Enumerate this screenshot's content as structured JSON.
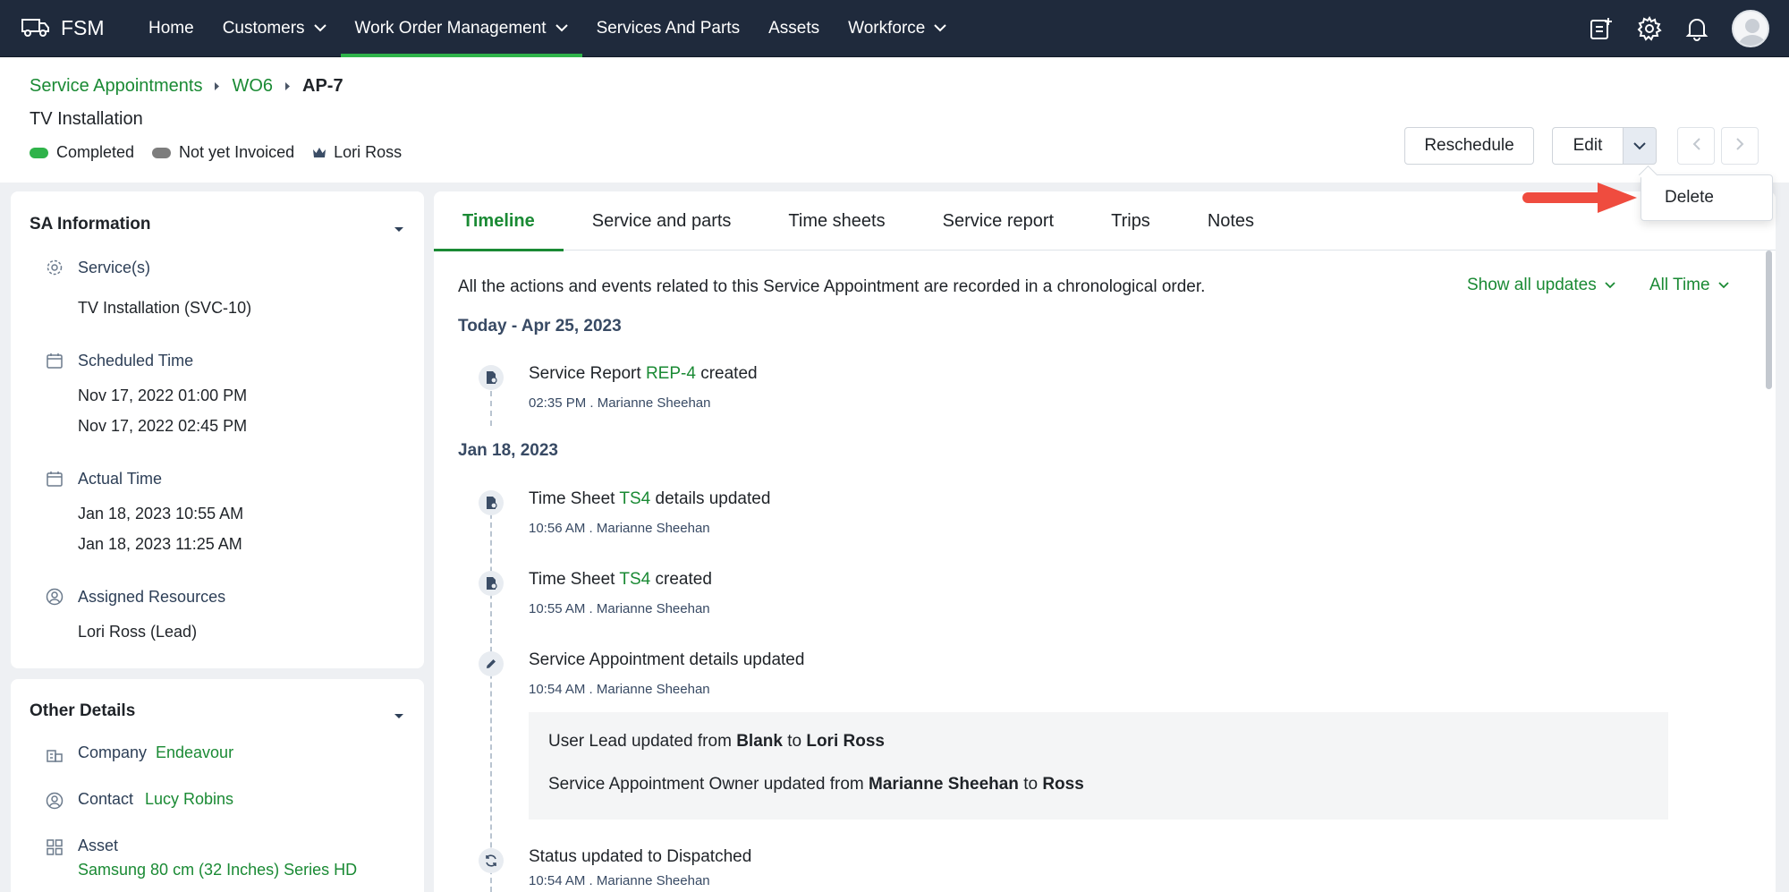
{
  "app": {
    "name": "FSM"
  },
  "nav": {
    "items": [
      {
        "label": "Home"
      },
      {
        "label": "Customers"
      },
      {
        "label": "Work Order Management"
      },
      {
        "label": "Services And Parts"
      },
      {
        "label": "Assets"
      },
      {
        "label": "Workforce"
      }
    ]
  },
  "breadcrumb": {
    "level1": "Service Appointments",
    "level2": "WO6",
    "current": "AP-7"
  },
  "header": {
    "title": "TV Installation",
    "status": "Completed",
    "invoice_status": "Not yet Invoiced",
    "owner": "Lori Ross",
    "reschedule_label": "Reschedule",
    "edit_label": "Edit"
  },
  "dropdown": {
    "delete_label": "Delete"
  },
  "colors": {
    "accent": "#1a8a34",
    "nav_bg": "#1f2a3c",
    "completed": "#2fb34a",
    "not_invoiced": "#7d7d7d",
    "annotation": "#ef4c3f"
  },
  "sa_info": {
    "title": "SA Information",
    "services_label": "Service(s)",
    "services_value": "TV Installation (SVC-10)",
    "scheduled_label": "Scheduled Time",
    "scheduled_start": "Nov 17, 2022 01:00 PM",
    "scheduled_end": "Nov 17, 2022 02:45 PM",
    "actual_label": "Actual Time",
    "actual_start": "Jan 18, 2023 10:55 AM",
    "actual_end": "Jan 18, 2023 11:25 AM",
    "resources_label": "Assigned Resources",
    "resources_value": "Lori Ross (Lead)"
  },
  "other_details": {
    "title": "Other Details",
    "company_label": "Company",
    "company_value": "Endeavour",
    "contact_label": "Contact",
    "contact_value": "Lucy Robins",
    "asset_label": "Asset",
    "asset_value": "Samsung 80 cm (32 Inches) Series HD"
  },
  "tabs": [
    {
      "label": "Timeline"
    },
    {
      "label": "Service and parts"
    },
    {
      "label": "Time sheets"
    },
    {
      "label": "Service report"
    },
    {
      "label": "Trips"
    },
    {
      "label": "Notes"
    }
  ],
  "timeline": {
    "intro": "All the actions and events related to this Service Appointment are recorded in a chronological order.",
    "filter_updates": "Show all updates",
    "filter_time": "All Time",
    "groups": [
      {
        "date": "Today - Apr 25, 2023"
      },
      {
        "date": "Jan 18, 2023"
      }
    ],
    "events": [
      {
        "prefix": "Service Report ",
        "link": "REP-4",
        "suffix": " created",
        "meta": "02:35 PM . Marianne Sheehan"
      },
      {
        "prefix": "Time Sheet ",
        "link": "TS4",
        "suffix": " details updated",
        "meta": "10:56 AM . Marianne Sheehan"
      },
      {
        "prefix": "Time Sheet ",
        "link": "TS4",
        "suffix": " created",
        "meta": "10:55 AM . Marianne Sheehan"
      },
      {
        "text": "Service Appointment details updated",
        "meta": "10:54 AM . Marianne Sheehan"
      },
      {
        "text": "Status updated to Dispatched",
        "meta": "10:54 AM . Marianne Sheehan"
      }
    ],
    "details": {
      "line1_prefix": "User Lead updated from ",
      "line1_from": "Blank",
      "line1_mid": " to ",
      "line1_to": "Lori Ross",
      "line2_prefix": "Service Appointment Owner updated from ",
      "line2_from": "Marianne Sheehan",
      "line2_mid": " to ",
      "line2_to": "Ross"
    }
  }
}
